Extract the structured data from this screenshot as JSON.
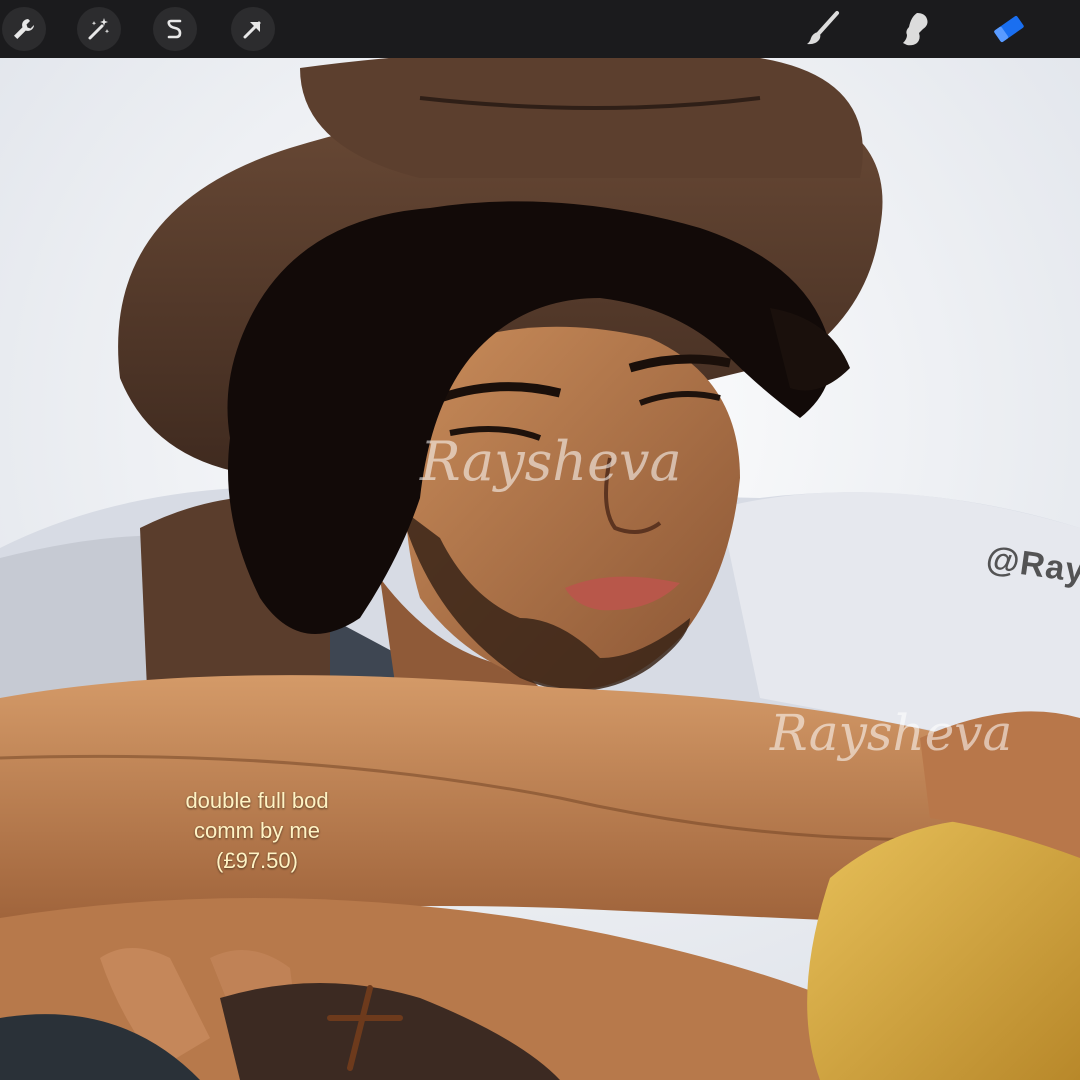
{
  "app": {
    "toolbar": {
      "left_tools": [
        {
          "icon": "wrench-icon",
          "name": "actions"
        },
        {
          "icon": "magic-wand-icon",
          "name": "adjustments"
        },
        {
          "icon": "selection-icon",
          "name": "selection"
        },
        {
          "icon": "arrow-cursor-icon",
          "name": "transform"
        }
      ],
      "right_tools": [
        {
          "icon": "brush-icon",
          "name": "paint"
        },
        {
          "icon": "smudge-icon",
          "name": "smudge"
        },
        {
          "icon": "eraser-icon",
          "name": "erase",
          "active": true
        }
      ],
      "active_color": "#1a6ff0"
    }
  },
  "canvas": {
    "caption_lines": [
      "double full bod",
      "comm by me",
      "(£97.50)"
    ],
    "artist_handle": "@Ray",
    "watermark_text": "Raysheva"
  }
}
